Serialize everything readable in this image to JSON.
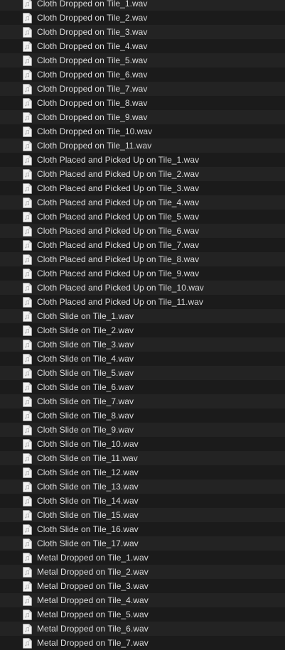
{
  "file_icon": "audio-file-icon",
  "colors": {
    "background": "#1e1e1e",
    "row_alt": "#232323",
    "text": "#dcdcdc"
  },
  "files": [
    {
      "name": "Cloth Dropped on Tile_1.wav"
    },
    {
      "name": "Cloth Dropped on Tile_2.wav"
    },
    {
      "name": "Cloth Dropped on Tile_3.wav"
    },
    {
      "name": "Cloth Dropped on Tile_4.wav"
    },
    {
      "name": "Cloth Dropped on Tile_5.wav"
    },
    {
      "name": "Cloth Dropped on Tile_6.wav"
    },
    {
      "name": "Cloth Dropped on Tile_7.wav"
    },
    {
      "name": "Cloth Dropped on Tile_8.wav"
    },
    {
      "name": "Cloth Dropped on Tile_9.wav"
    },
    {
      "name": "Cloth Dropped on Tile_10.wav"
    },
    {
      "name": "Cloth Dropped on Tile_11.wav"
    },
    {
      "name": "Cloth Placed and Picked Up on Tile_1.wav"
    },
    {
      "name": "Cloth Placed and Picked Up on Tile_2.wav"
    },
    {
      "name": "Cloth Placed and Picked Up on Tile_3.wav"
    },
    {
      "name": "Cloth Placed and Picked Up on Tile_4.wav"
    },
    {
      "name": "Cloth Placed and Picked Up on Tile_5.wav"
    },
    {
      "name": "Cloth Placed and Picked Up on Tile_6.wav"
    },
    {
      "name": "Cloth Placed and Picked Up on Tile_7.wav"
    },
    {
      "name": "Cloth Placed and Picked Up on Tile_8.wav"
    },
    {
      "name": "Cloth Placed and Picked Up on Tile_9.wav"
    },
    {
      "name": "Cloth Placed and Picked Up on Tile_10.wav"
    },
    {
      "name": "Cloth Placed and Picked Up on Tile_11.wav"
    },
    {
      "name": "Cloth Slide on Tile_1.wav"
    },
    {
      "name": "Cloth Slide on Tile_2.wav"
    },
    {
      "name": "Cloth Slide on Tile_3.wav"
    },
    {
      "name": "Cloth Slide on Tile_4.wav"
    },
    {
      "name": "Cloth Slide on Tile_5.wav"
    },
    {
      "name": "Cloth Slide on Tile_6.wav"
    },
    {
      "name": "Cloth Slide on Tile_7.wav"
    },
    {
      "name": "Cloth Slide on Tile_8.wav"
    },
    {
      "name": "Cloth Slide on Tile_9.wav"
    },
    {
      "name": "Cloth Slide on Tile_10.wav"
    },
    {
      "name": "Cloth Slide on Tile_11.wav"
    },
    {
      "name": "Cloth Slide on Tile_12.wav"
    },
    {
      "name": "Cloth Slide on Tile_13.wav"
    },
    {
      "name": "Cloth Slide on Tile_14.wav"
    },
    {
      "name": "Cloth Slide on Tile_15.wav"
    },
    {
      "name": "Cloth Slide on Tile_16.wav"
    },
    {
      "name": "Cloth Slide on Tile_17.wav"
    },
    {
      "name": "Metal Dropped on Tile_1.wav"
    },
    {
      "name": "Metal Dropped on Tile_2.wav"
    },
    {
      "name": "Metal Dropped on Tile_3.wav"
    },
    {
      "name": "Metal Dropped on Tile_4.wav"
    },
    {
      "name": "Metal Dropped on Tile_5.wav"
    },
    {
      "name": "Metal Dropped on Tile_6.wav"
    },
    {
      "name": "Metal Dropped on Tile_7.wav"
    }
  ]
}
